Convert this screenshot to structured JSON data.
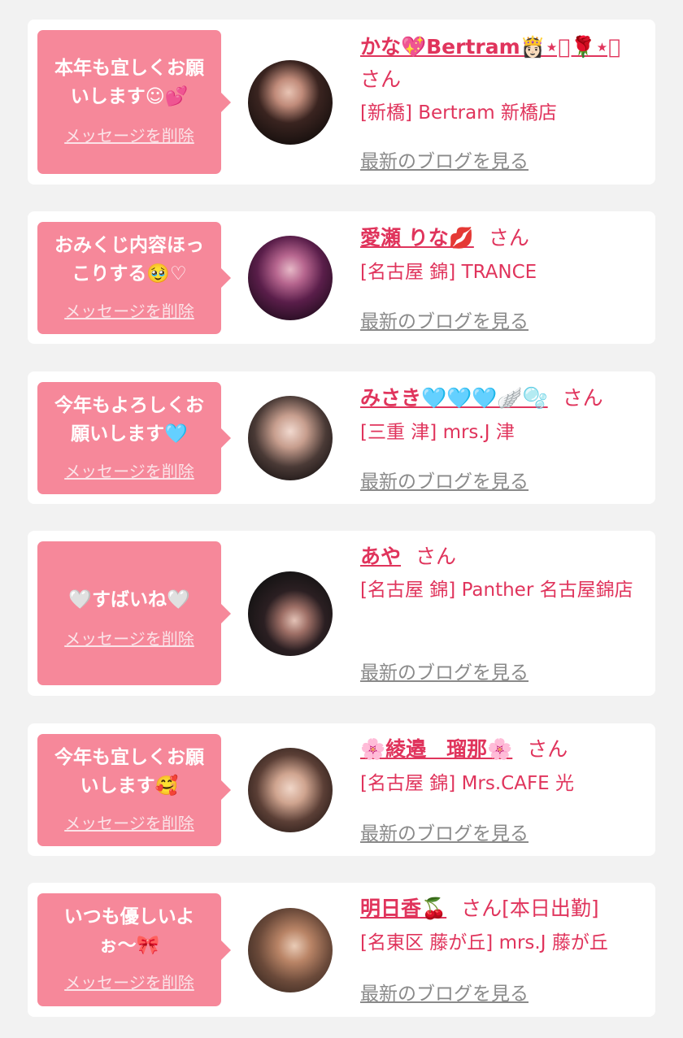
{
  "delete_label": "メッセージを削除",
  "blog_link_label": "最新のブログを見る",
  "honorific": "さん",
  "colors": {
    "background": "#f2f2f2",
    "card": "#ffffff",
    "bubble": "#f6889a",
    "name": "#e0345c",
    "link_gray": "#8a8a8a"
  },
  "items": [
    {
      "message": "本年も宜しくお願\nいします☺💕",
      "name": "かな💖Bertram👸🏻⋆͛🌹⋆͛",
      "status": "",
      "shop": "[新橋] Bertram 新橋店"
    },
    {
      "message": "おみくじ内容ほっ\nこりする🥹♡",
      "name": "愛瀬 りな💋",
      "status": "",
      "shop": "[名古屋 錦] TRANCE"
    },
    {
      "message": "今年もよろしくお\n願いします🩵",
      "name": "みさき🩵🩵🩵🪽🫧",
      "status": "",
      "shop": "[三重 津] mrs.J 津"
    },
    {
      "message": "🤍すばいね🤍",
      "name": "あや",
      "status": "",
      "shop": "[名古屋 錦] Panther 名古屋錦店"
    },
    {
      "message": "今年も宜しくお願\nいします🥰",
      "name": "🌸綾邉　瑠那🌸",
      "status": "",
      "shop": "[名古屋 錦] Mrs.CAFE 光"
    },
    {
      "message": "いつも優しいよ\nぉ〜🎀",
      "name": "明日香🍒",
      "status": "[本日出勤]",
      "shop": "[名東区 藤が丘] mrs.J 藤が丘"
    }
  ]
}
